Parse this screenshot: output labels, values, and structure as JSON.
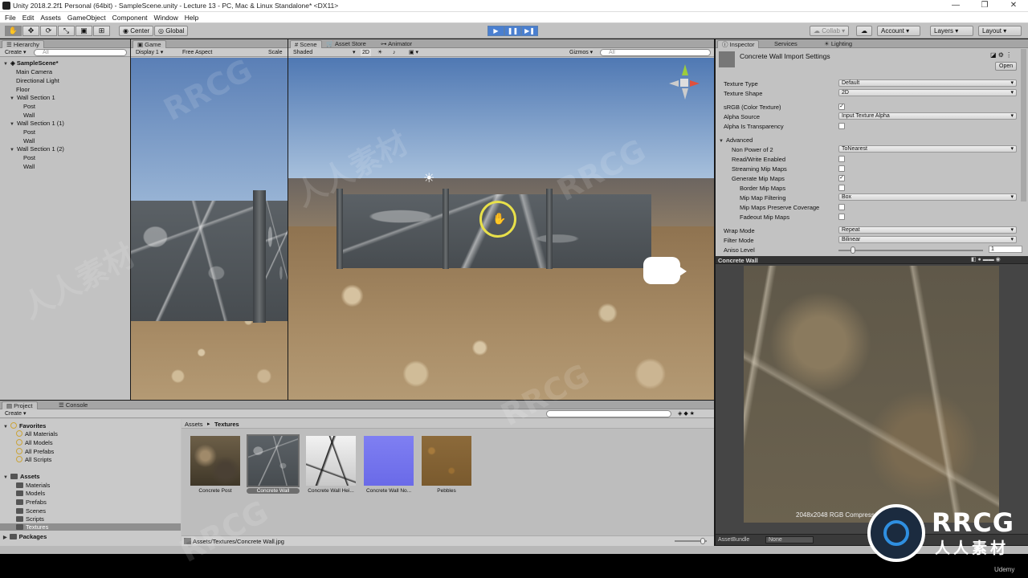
{
  "window": {
    "title": "Unity 2018.2.2f1 Personal (64bit) - SampleScene.unity - Lecture 13 - PC, Mac & Linux Standalone* <DX11>",
    "controls": [
      "—",
      "❐",
      "✕"
    ]
  },
  "menu": [
    "File",
    "Edit",
    "Assets",
    "GameObject",
    "Component",
    "Window",
    "Help"
  ],
  "toolbar": {
    "center_label": "Center",
    "global_label": "Global",
    "collab_label": "Collab ▾",
    "account_label": "Account",
    "layers_label": "Layers",
    "layout_label": "Layout"
  },
  "hierarchy": {
    "tab": "Hierarchy",
    "create_label": "Create ▾",
    "search_placeholder": "All",
    "scene_name": "SampleScene*",
    "items": [
      "Main Camera",
      "Directional Light",
      "Floor"
    ],
    "sections": [
      {
        "name": "Wall Section 1",
        "children": [
          "Post",
          "Wall"
        ]
      },
      {
        "name": "Wall Section 1 (1)",
        "children": [
          "Post",
          "Wall"
        ]
      },
      {
        "name": "Wall Section 1 (2)",
        "children": [
          "Post",
          "Wall"
        ]
      }
    ]
  },
  "game_view": {
    "tab": "Game",
    "display": "Display 1",
    "aspect": "Free Aspect",
    "scale": "Scale"
  },
  "scene_view": {
    "tabs": [
      "Scene",
      "Asset Store",
      "Animator"
    ],
    "shading": "Shaded",
    "mode_2d": "2D",
    "gizmos": "Gizmos",
    "search_placeholder": "All"
  },
  "inspector": {
    "tabs": [
      "Inspector",
      "Services",
      "Lighting"
    ],
    "title": "Concrete Wall Import Settings",
    "open_label": "Open",
    "rows": [
      {
        "label": "Texture Type",
        "kind": "select",
        "value": "Default"
      },
      {
        "label": "Texture Shape",
        "kind": "select",
        "value": "2D"
      },
      {
        "label": "sRGB (Color Texture)",
        "kind": "check",
        "value": true
      },
      {
        "label": "Alpha Source",
        "kind": "select",
        "value": "Input Texture Alpha"
      },
      {
        "label": "Alpha Is Transparency",
        "kind": "check",
        "value": false
      }
    ],
    "advanced_label": "Advanced",
    "advanced_rows": [
      {
        "label": "Non Power of 2",
        "kind": "select",
        "value": "ToNearest"
      },
      {
        "label": "Read/Write Enabled",
        "kind": "check",
        "value": false
      },
      {
        "label": "Streaming Mip Maps",
        "kind": "check",
        "value": false
      },
      {
        "label": "Generate Mip Maps",
        "kind": "check",
        "value": true
      },
      {
        "label": "Border Mip Maps",
        "kind": "check",
        "value": false
      },
      {
        "label": "Mip Map Filtering",
        "kind": "select",
        "value": "Box"
      },
      {
        "label": "Mip Maps Preserve Coverage",
        "kind": "check",
        "value": false
      },
      {
        "label": "Fadeout Mip Maps",
        "kind": "check",
        "value": false
      }
    ],
    "bottom_rows": [
      {
        "label": "Wrap Mode",
        "kind": "select",
        "value": "Repeat"
      },
      {
        "label": "Filter Mode",
        "kind": "select",
        "value": "Bilinear"
      },
      {
        "label": "Aniso Level",
        "kind": "slider",
        "value": "1"
      }
    ],
    "preview_title": "Concrete Wall",
    "preview_info": "2048x2048  RGB Compressed DXT1  2.7",
    "assetbundle_label": "AssetBundle",
    "assetbundle_value": "None"
  },
  "project": {
    "tabs": [
      "Project",
      "Console"
    ],
    "create_label": "Create ▾",
    "favorites_label": "Favorites",
    "favorites": [
      "All Materials",
      "All Models",
      "All Prefabs",
      "All Scripts"
    ],
    "assets_label": "Assets",
    "folders": [
      "Materials",
      "Models",
      "Prefabs",
      "Scenes",
      "Scripts",
      "Textures"
    ],
    "packages_label": "Packages",
    "breadcrumb_root": "Assets",
    "breadcrumb_current": "Textures",
    "assets": [
      "Concrete Post",
      "Concrete Wall",
      "Concrete Wall Hei...",
      "Concrete Wall No...",
      "Pebbles"
    ],
    "path": "Assets/Textures/Concrete Wall.jpg"
  },
  "branding": {
    "watermark": "人人素材",
    "watermark_latin": "RRCG",
    "logo_text": "RRCG",
    "logo_sub": "人人素材",
    "udemy": "Udemy"
  },
  "colors": {
    "play_blue": "#4a7fd0",
    "selection": "#3d6fb8",
    "gizmo_yellow": "#e8e04a"
  }
}
